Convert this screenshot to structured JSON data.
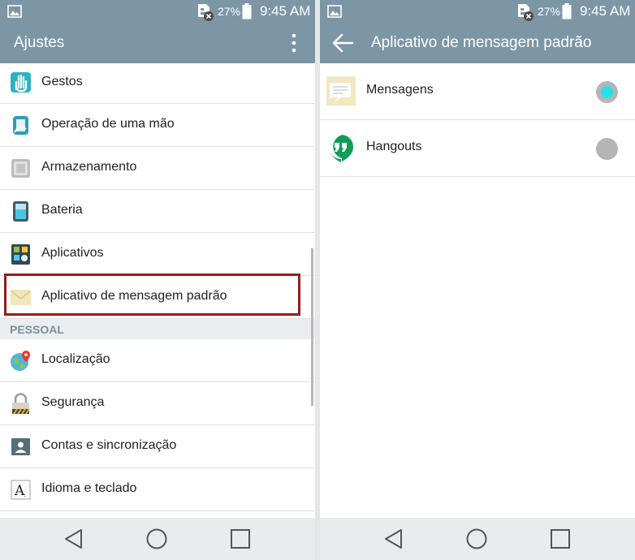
{
  "left": {
    "status_bar": {
      "battery_percent": "27%",
      "time": "9:45 AM"
    },
    "app_bar": {
      "title": "Ajustes"
    },
    "items_top": [
      {
        "label": "Gestos",
        "icon": "hand-gesture-icon"
      },
      {
        "label": "Operação de uma mão",
        "icon": "one-hand-icon"
      },
      {
        "label": "Armazenamento",
        "icon": "storage-icon"
      },
      {
        "label": "Bateria",
        "icon": "battery-icon"
      },
      {
        "label": "Aplicativos",
        "icon": "apps-icon"
      },
      {
        "label": "Aplicativo de mensagem padrão",
        "icon": "envelope-icon",
        "highlighted": true
      }
    ],
    "section_header": "PESSOAL",
    "items_personal": [
      {
        "label": "Localização",
        "icon": "location-globe-icon"
      },
      {
        "label": "Segurança",
        "icon": "padlock-icon"
      },
      {
        "label": "Contas e sincronização",
        "icon": "accounts-icon"
      },
      {
        "label": "Idioma e teclado",
        "icon": "language-icon"
      }
    ],
    "highlight_color": "#9a1b1b"
  },
  "right": {
    "status_bar": {
      "battery_percent": "27%",
      "time": "9:45 AM"
    },
    "app_bar": {
      "title": "Aplicativo de mensagem padrão"
    },
    "options": [
      {
        "label": "Mensagens",
        "icon": "messages-app-icon",
        "selected": true
      },
      {
        "label": "Hangouts",
        "icon": "hangouts-icon",
        "selected": false
      }
    ]
  },
  "colors": {
    "app_bar": "#7d96a6",
    "selected_radio": "#25e0e8",
    "unselected_radio": "#b5b5b5",
    "hangouts_green": "#0f9d58"
  }
}
